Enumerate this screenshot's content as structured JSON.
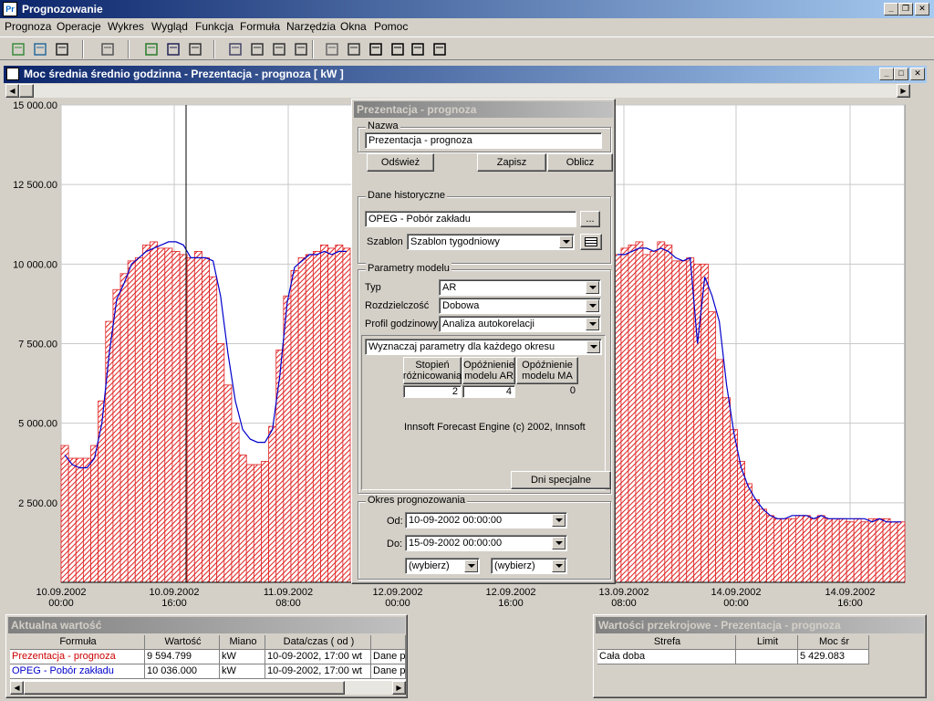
{
  "app": {
    "title": "Prognozowanie"
  },
  "menu": [
    "Prognoza",
    "Operacje",
    "Wykres",
    "Wygląd",
    "Funkcja",
    "Formuła",
    "Narzędzia",
    "Okna",
    "Pomoc"
  ],
  "toolbar": {
    "icons": [
      "open-icon",
      "open-folder-icon",
      "save-icon",
      "exit-icon",
      "calculator-icon",
      "bar-chart-icon",
      "list-icon",
      "refresh-icon",
      "print-preview-icon",
      "print-icon",
      "chart-type-icon",
      "house-icon",
      "zoom-icon",
      "tile-vertical-icon",
      "tile-horizontal-icon",
      "window-icon",
      "cascade-icon"
    ]
  },
  "chart_window": {
    "title": "Moc średnia średnio godzinna - Prezentacja - prognoza [ kW ]"
  },
  "chart_data": {
    "type": "bar",
    "title": "",
    "xlabel": "",
    "ylabel": "",
    "ylim": [
      0,
      15000
    ],
    "yticks": [
      "2 500.00",
      "5 000.00",
      "7 500.00",
      "10 000.00",
      "12 500.00",
      "15 000.00"
    ],
    "xticks": [
      {
        "date": "10.09.2002",
        "time": "00:00"
      },
      {
        "date": "10.09.2002",
        "time": "16:00"
      },
      {
        "date": "11.09.2002",
        "time": "08:00"
      },
      {
        "date": "12.09.2002",
        "time": "00:00"
      },
      {
        "date": "12.09.2002",
        "time": "16:00"
      },
      {
        "date": "13.09.2002",
        "time": "08:00"
      },
      {
        "date": "14.09.2002",
        "time": "00:00"
      },
      {
        "date": "14.09.2002",
        "time": "16:00"
      }
    ],
    "bars_left": [
      4300,
      3900,
      3900,
      3900,
      4300,
      5700,
      8200,
      9200,
      9700,
      10100,
      10200,
      10600,
      10700,
      10500,
      10500,
      10400,
      10300,
      10200,
      10400,
      10200,
      9600,
      7500,
      6200,
      5000,
      4000,
      3700,
      3700,
      3800,
      4900,
      7300,
      9000,
      9800,
      10200,
      10300,
      10400,
      10600,
      10500,
      10600,
      10500
    ],
    "line_left": [
      4000,
      3700,
      3600,
      3600,
      3900,
      5000,
      7200,
      8900,
      9400,
      10000,
      10200,
      10400,
      10500,
      10600,
      10700,
      10700,
      10600,
      10200,
      10200,
      10200,
      10100,
      9000,
      7200,
      5700,
      4800,
      4500,
      4400,
      4400,
      4800,
      6500,
      8800,
      9900,
      10100,
      10300,
      10300,
      10400,
      10300,
      10400,
      10400
    ],
    "bars_right": [
      10300,
      10500,
      10600,
      10700,
      10300,
      10400,
      10700,
      10600,
      10100,
      10100,
      10200,
      10000,
      10000,
      8500,
      7000,
      5800,
      4800,
      3800,
      3100,
      2600,
      2300,
      2100,
      2000,
      2000,
      2000,
      2100,
      2100,
      2000,
      2100,
      2000,
      2000,
      2000,
      1900,
      2000,
      1900,
      2000,
      2000,
      2000,
      1900,
      1900
    ],
    "line_right": [
      10300,
      10300,
      10400,
      10500,
      10500,
      10400,
      10500,
      10400,
      10200,
      10100,
      10200,
      7500,
      9600,
      9000,
      8200,
      6200,
      4700,
      3600,
      3000,
      2600,
      2300,
      2100,
      2000,
      2000,
      2100,
      2100,
      2100,
      2000,
      2100,
      2000,
      2000,
      2000,
      2000,
      2000,
      2000,
      1900,
      2000,
      1900,
      1900,
      1900
    ],
    "colors": {
      "bar": "#e02020",
      "line": "#0000cc",
      "cursor": "#000000"
    }
  },
  "dialog": {
    "title": "Prezentacja - prognoza",
    "nazwa_label": "Nazwa",
    "nazwa_value": "Prezentacja - prognoza",
    "btn_odswiez": "Odśwież",
    "btn_zapisz": "Zapisz",
    "btn_oblicz": "Oblicz",
    "hist_label": "Dane historyczne",
    "hist_value": "OPEG - Pobór zakładu",
    "hist_browse": "...",
    "szablon_label": "Szablon",
    "szablon_value": "Szablon tygodniowy",
    "param_label": "Parametry modelu",
    "typ_label": "Typ",
    "typ_value": "AR",
    "rozdz_label": "Rozdzielczość",
    "rozdz_value": "Dobowa",
    "profil_label": "Profil godzinowy",
    "profil_value": "Analiza autokorelacji",
    "wyzn_value": "Wyznaczaj parametry dla każdego okresu",
    "col1": "Stopień różnicowania",
    "col2": "Opóźnienie modelu AR",
    "col3": "Opóźnienie modelu MA",
    "val1": "2",
    "val2": "4",
    "val3": "0",
    "engine": "Innsoft Forecast Engine  (c) 2002, Innsoft",
    "btn_dni": "Dni specjalne",
    "okres_label": "Okres prognozowania",
    "od_label": "Od:",
    "od_value": "10-09-2002 00:00:00",
    "do_label": "Do:",
    "do_value": "15-09-2002 00:00:00",
    "wybierz1": "(wybierz)",
    "wybierz2": "(wybierz)"
  },
  "current": {
    "title": "Aktualna wartość",
    "headers": [
      "Formuła",
      "Wartość",
      "Miano",
      "Data/czas ( od )",
      ""
    ],
    "rows": [
      {
        "name": "Prezentacja - prognoza",
        "value": "9 594.799",
        "unit": "kW",
        "date": "10-09-2002, 17:00 wt",
        "extra": "Dane pe",
        "color": "#cc0000"
      },
      {
        "name": "OPEG - Pobór zakładu",
        "value": "10 036.000",
        "unit": "kW",
        "date": "10-09-2002, 17:00 wt",
        "extra": "Dane pe",
        "color": "#0000cc"
      }
    ]
  },
  "cross": {
    "title": "Wartości przekrojowe - Prezentacja - prognoza",
    "headers": [
      "Strefa",
      "Limit",
      "Moc śr"
    ],
    "rows": [
      {
        "strefa": "Cała doba",
        "limit": "",
        "moc": "5 429.083"
      }
    ]
  }
}
